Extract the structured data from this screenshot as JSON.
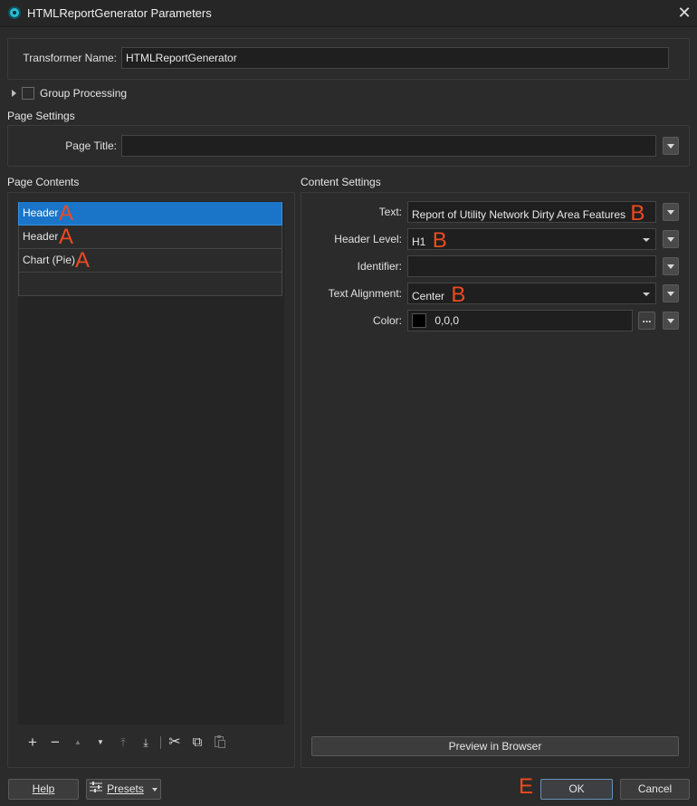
{
  "window": {
    "title": "HTMLReportGenerator Parameters",
    "close_glyph": "✕"
  },
  "transformer": {
    "label": "Transformer Name:",
    "value": "HTMLReportGenerator"
  },
  "group_processing": {
    "label": "Group Processing",
    "checked": false
  },
  "page_settings": {
    "section_label": "Page Settings",
    "page_title_label": "Page Title:",
    "page_title_value": ""
  },
  "page_contents": {
    "section_label": "Page Contents",
    "items": [
      {
        "label": "Header",
        "marker": "A",
        "selected": true
      },
      {
        "label": "Header",
        "marker": "A",
        "selected": false
      },
      {
        "label": "Chart (Pie)",
        "marker": "A",
        "selected": false
      },
      {
        "label": "",
        "marker": "",
        "selected": false
      }
    ],
    "toolbar": {
      "add": "+",
      "remove": "−",
      "move_up": "▲",
      "move_down": "▼",
      "move_top": "⤒",
      "move_bottom": "⤓",
      "cut": "✂",
      "copy": "⧉",
      "paste": "📋"
    }
  },
  "content_settings": {
    "section_label": "Content Settings",
    "text_label": "Text:",
    "text_value": "Report of Utility Network Dirty Area Features",
    "text_marker": "B",
    "header_level_label": "Header Level:",
    "header_level_value": "H1",
    "header_level_marker": "B",
    "identifier_label": "Identifier:",
    "identifier_value": "",
    "alignment_label": "Text Alignment:",
    "alignment_value": "Center",
    "alignment_marker": "B",
    "color_label": "Color:",
    "color_value": "0,0,0",
    "color_swatch": "#000000",
    "color_browse": "...",
    "preview_button": "Preview in Browser"
  },
  "footer": {
    "help": "Help",
    "presets": "Presets",
    "ok": "OK",
    "ok_marker": "E",
    "cancel": "Cancel"
  },
  "colors": {
    "selection": "#1a75c9",
    "marker": "#ee4a22",
    "background": "#2b2b2b"
  }
}
